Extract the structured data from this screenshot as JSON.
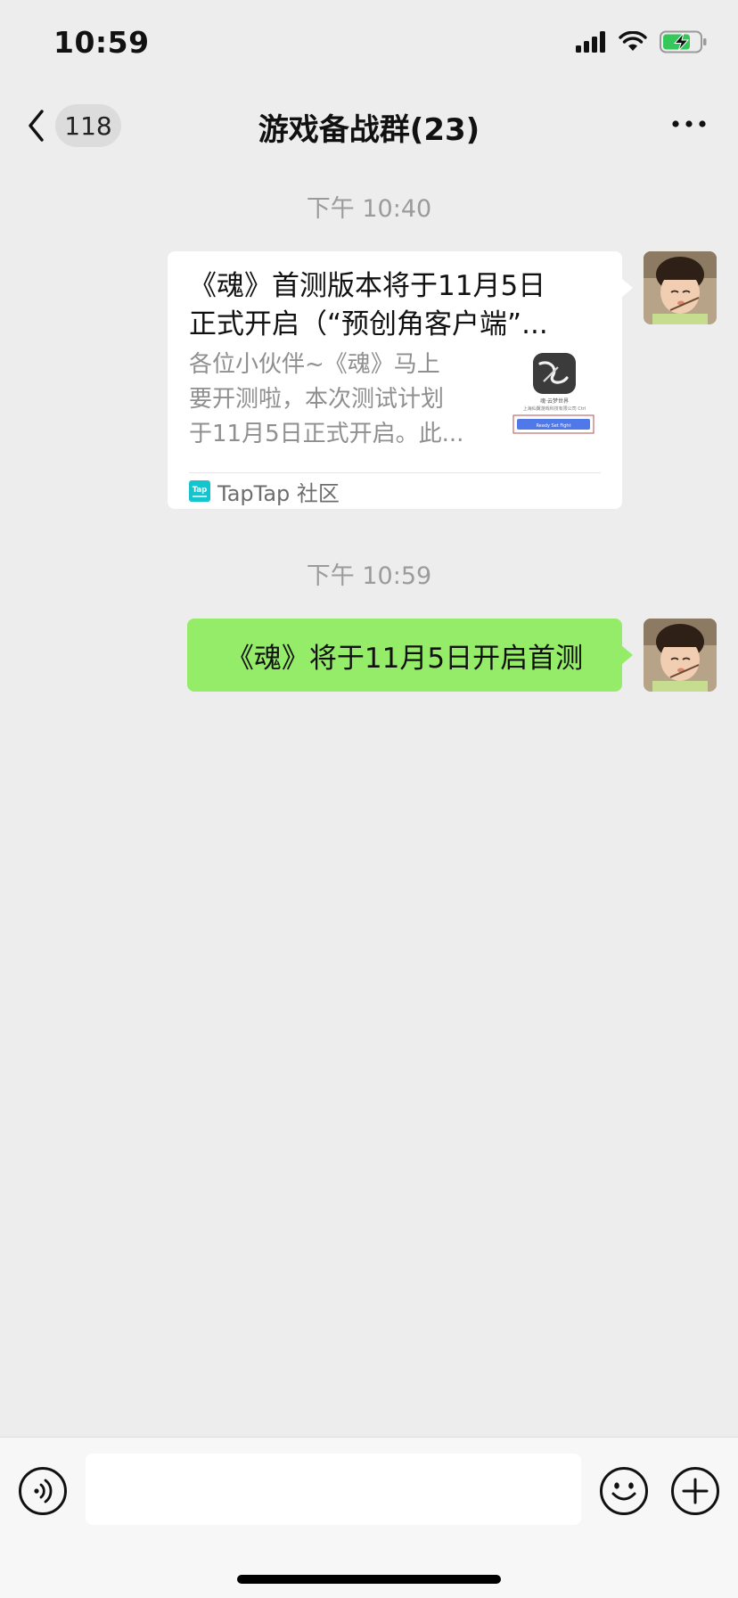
{
  "status_bar": {
    "time": "10:59"
  },
  "nav": {
    "unread_count": "118",
    "title": "游戏备战群(23)"
  },
  "messages": [
    {
      "timestamp": "下午 10:40",
      "type": "link",
      "title_line1": "《魂》首测版本将于11月5日",
      "title_line2": "正式开启（“预创角客户端”...",
      "desc_lines": [
        "各位小伙伴~《魂》马上",
        "要开测啦，本次测试计划",
        "于11月5日正式开启。此..."
      ],
      "thumb_caption": "魂·云梦世界",
      "thumb_sub": "上海仙翼游戏科技有限公司 Ctrl",
      "thumb_button": "Ready Set Fight",
      "source_icon_text": "Tap",
      "source": "TapTap 社区"
    },
    {
      "timestamp": "下午 10:59",
      "type": "text",
      "text": "《魂》将于11月5日开启首测"
    }
  ],
  "input": {
    "placeholder": ""
  },
  "colors": {
    "background": "#ededed",
    "bubble_green": "#95ec69",
    "timestamp_gray": "#9b9b9b",
    "battery_green": "#34c759",
    "taptap_teal": "#15c5ce"
  }
}
